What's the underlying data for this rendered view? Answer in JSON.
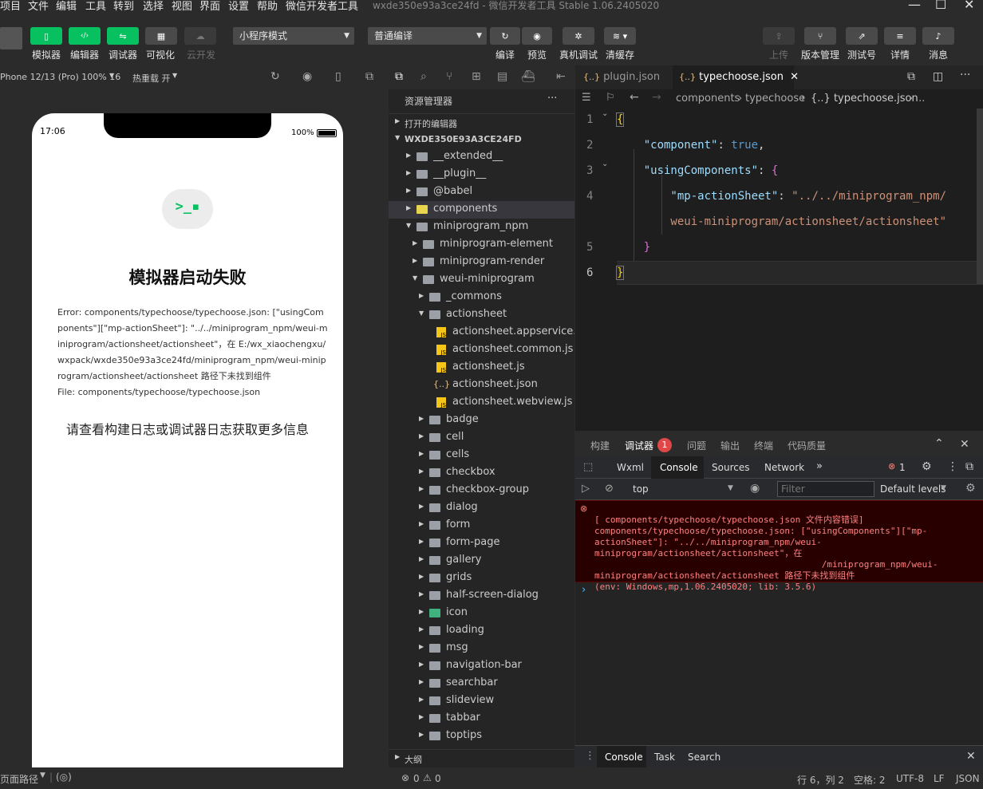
{
  "menu": [
    "项目",
    "文件",
    "编辑",
    "工具",
    "转到",
    "选择",
    "视图",
    "界面",
    "设置",
    "帮助",
    "微信开发者工具"
  ],
  "window_title": "wxde350e93a3ce24fd - 微信开发者工具 Stable 1.06.2405020",
  "toolbar": {
    "simulator": "模拟器",
    "editor": "编辑器",
    "debugger": "调试器",
    "visual": "可视化",
    "cloud": "云开发",
    "mode": "小程序模式",
    "compile_mode": "普通编译",
    "compile": "编译",
    "preview": "预览",
    "remote_debug": "真机调试",
    "clear_cache": "清缓存",
    "upload": "上传",
    "version": "版本管理",
    "test": "测试号",
    "details": "详情",
    "messages": "消息"
  },
  "sim": {
    "device": "Phone 12/13 (Pro) 100% 16",
    "hot_reload": "热重载 开",
    "time": "17:06",
    "battery": "100%",
    "error_title": "模拟器启动失败",
    "error_lines": [
      "Error: components/typechoose/typechoose.json: [\"usingCom",
      "ponents\"][\"mp-actionSheet\"]: \"../../miniprogram_npm/weui-m",
      "iniprogram/actionsheet/actionsheet\"，在 E:/wx_xiaochengxu/",
      "wxpack/wxde350e93a3ce24fd/miniprogram_npm/weui-minip",
      "rogram/actionsheet/actionsheet 路径下未找到组件",
      "File: components/typechoose/typechoose.json"
    ],
    "hint": "请查看构建日志或调试器日志获取更多信息",
    "status_path": "页面路径"
  },
  "explorer": {
    "title": "资源管理器",
    "more": "···",
    "open_editors": "打开的编辑器",
    "root": "WXDE350E93A3CE24FD",
    "outline": "大纲",
    "rows": [
      {
        "label": "__extended__",
        "d": 1,
        "t": "folder",
        "o": false
      },
      {
        "label": "__plugin__",
        "d": 1,
        "t": "folder",
        "o": false
      },
      {
        "label": "@babel",
        "d": 1,
        "t": "folder",
        "o": false
      },
      {
        "label": "components",
        "d": 1,
        "t": "folder",
        "o": false,
        "sel": true
      },
      {
        "label": "miniprogram_npm",
        "d": 1,
        "t": "folder",
        "o": true
      },
      {
        "label": "miniprogram-element",
        "d": 2,
        "t": "folder",
        "o": false
      },
      {
        "label": "miniprogram-render",
        "d": 2,
        "t": "folder",
        "o": false
      },
      {
        "label": "weui-miniprogram",
        "d": 2,
        "t": "folder",
        "o": true
      },
      {
        "label": "_commons",
        "d": 3,
        "t": "folder",
        "o": false
      },
      {
        "label": "actionsheet",
        "d": 3,
        "t": "folder",
        "o": true
      },
      {
        "label": "actionsheet.appservice.js",
        "d": 4,
        "t": "js"
      },
      {
        "label": "actionsheet.common.js",
        "d": 4,
        "t": "js"
      },
      {
        "label": "actionsheet.js",
        "d": 4,
        "t": "js"
      },
      {
        "label": "actionsheet.json",
        "d": 4,
        "t": "json"
      },
      {
        "label": "actionsheet.webview.js",
        "d": 4,
        "t": "js"
      },
      {
        "label": "badge",
        "d": 3,
        "t": "folder",
        "o": false
      },
      {
        "label": "cell",
        "d": 3,
        "t": "folder",
        "o": false
      },
      {
        "label": "cells",
        "d": 3,
        "t": "folder",
        "o": false
      },
      {
        "label": "checkbox",
        "d": 3,
        "t": "folder",
        "o": false
      },
      {
        "label": "checkbox-group",
        "d": 3,
        "t": "folder",
        "o": false
      },
      {
        "label": "dialog",
        "d": 3,
        "t": "folder",
        "o": false
      },
      {
        "label": "form",
        "d": 3,
        "t": "folder",
        "o": false
      },
      {
        "label": "form-page",
        "d": 3,
        "t": "folder",
        "o": false
      },
      {
        "label": "gallery",
        "d": 3,
        "t": "folder",
        "o": false
      },
      {
        "label": "grids",
        "d": 3,
        "t": "folder",
        "o": false
      },
      {
        "label": "half-screen-dialog",
        "d": 3,
        "t": "folder",
        "o": false
      },
      {
        "label": "icon",
        "d": 3,
        "t": "folder",
        "o": false,
        "green": true
      },
      {
        "label": "loading",
        "d": 3,
        "t": "folder",
        "o": false
      },
      {
        "label": "msg",
        "d": 3,
        "t": "folder",
        "o": false
      },
      {
        "label": "navigation-bar",
        "d": 3,
        "t": "folder",
        "o": false
      },
      {
        "label": "searchbar",
        "d": 3,
        "t": "folder",
        "o": false
      },
      {
        "label": "slideview",
        "d": 3,
        "t": "folder",
        "o": false
      },
      {
        "label": "tabbar",
        "d": 3,
        "t": "folder",
        "o": false
      },
      {
        "label": "toptips",
        "d": 3,
        "t": "folder",
        "o": false
      }
    ]
  },
  "editor": {
    "tabs": [
      {
        "label": "plugin.json",
        "active": false
      },
      {
        "label": "typechoose.json",
        "active": true
      }
    ],
    "crumbs": [
      "components",
      "typechoose",
      "{..} typechoose.json",
      "..."
    ],
    "lines": [
      {
        "n": "1",
        "text": "{"
      },
      {
        "n": "2",
        "text": "    \"component\": true,"
      },
      {
        "n": "3",
        "text": "    \"usingComponents\": {"
      },
      {
        "n": "4",
        "text": "        \"mp-actionSheet\": \"../../miniprogram_npm/"
      },
      {
        "n": "",
        "text": "        weui-miniprogram/actionsheet/actionsheet\""
      },
      {
        "n": "5",
        "text": "    }"
      },
      {
        "n": "6",
        "text": "}"
      }
    ]
  },
  "debug": {
    "tabs": [
      "构建",
      "调试器",
      "问题",
      "输出",
      "终端",
      "代码质量"
    ],
    "badge": "1",
    "dev_tabs": [
      "Wxml",
      "Console",
      "Sources",
      "Network"
    ],
    "err_count": "1",
    "context": "top",
    "filter_placeholder": "Filter",
    "levels": "Default levels",
    "error_lines": [
      "[ components/typechoose/typechoose.json 文件内容错误]",
      "components/typechoose/typechoose.json: [\"usingComponents\"][\"mp-",
      "actionSheet\"]: \"../../miniprogram_npm/weui-",
      "miniprogram/actionsheet/actionsheet\"，在",
      "                                           /miniprogram_npm/weui-",
      "miniprogram/actionsheet/actionsheet 路径下未找到组件",
      "(env: Windows,mp,1.06.2405020; lib: 3.5.6)"
    ],
    "prompt": "›",
    "drawer_tabs": [
      "Console",
      "Task",
      "Search"
    ]
  },
  "status": {
    "errors": "0",
    "warnings": "0",
    "cursor": "行 6，列 2",
    "spaces": "空格: 2",
    "encoding": "UTF-8",
    "eol": "LF",
    "lang": "JSON"
  },
  "colors": {
    "green": "#07c160",
    "error_bg": "#290000",
    "error_text": "#ff8080"
  }
}
